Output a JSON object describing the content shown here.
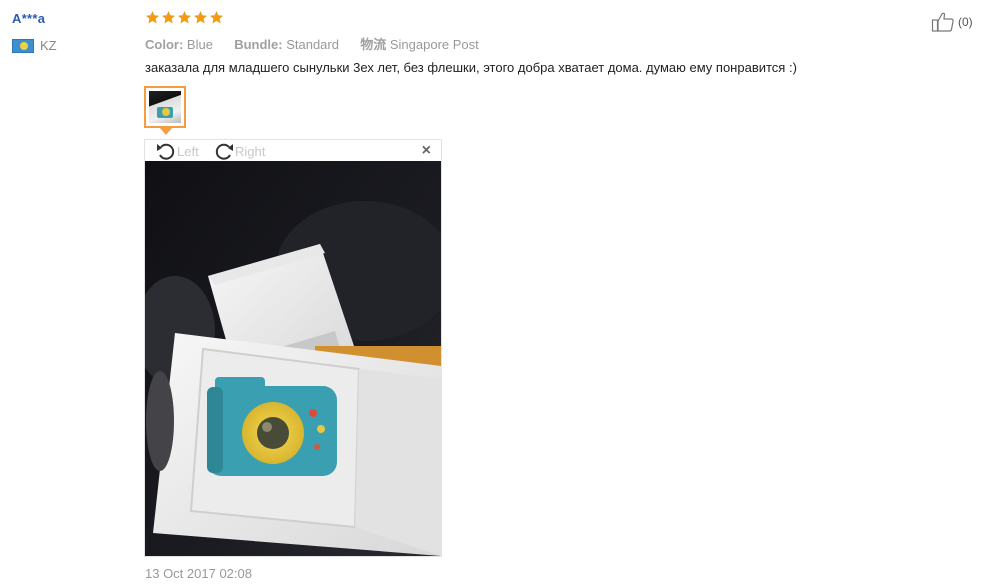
{
  "reviewer": {
    "name": "A***a",
    "country_code": "KZ",
    "flag_icon": "kazakhstan-flag-icon"
  },
  "review": {
    "rating": 5,
    "rating_color": "#f39c12",
    "color_label": "Color:",
    "color_value": "Blue",
    "bundle_label": "Bundle:",
    "bundle_value": "Standard",
    "shipping_label": "物流",
    "shipping_value": "Singapore Post",
    "text": "заказала для младшего сынульки 3ех лет, без флешки, этого добра хватает дома. думаю ему понравится :)",
    "timestamp": "13 Oct 2017 02:08"
  },
  "viewer": {
    "rotate_left_label": "Left",
    "rotate_right_label": "Right",
    "close_label": "×"
  },
  "helpful": {
    "count": "(0)",
    "icon": "thumbs-up-icon"
  },
  "colors": {
    "accent": "#f39c40",
    "username": "#2a5db0",
    "camera_body": "#3a9fb0",
    "camera_lens": "#e8c840"
  }
}
